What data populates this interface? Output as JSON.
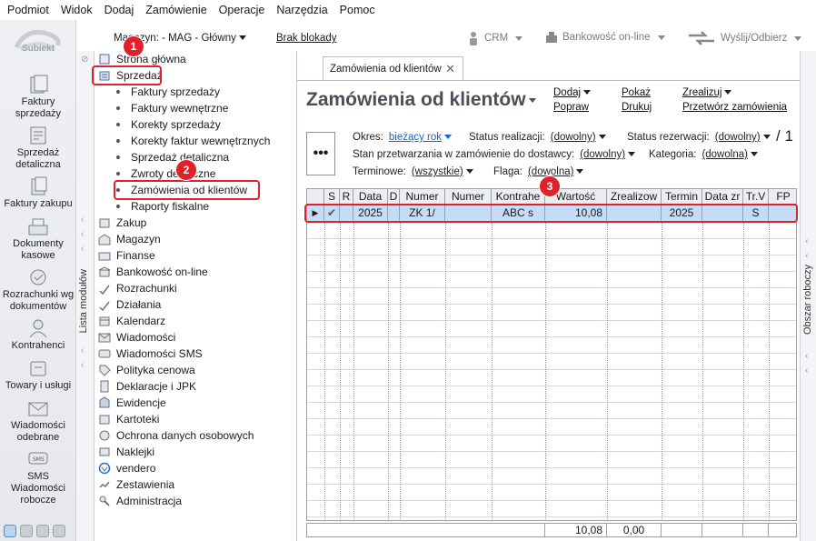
{
  "menu": [
    "Podmiot",
    "Widok",
    "Dodaj",
    "Zamówienie",
    "Operacje",
    "Narzędzia",
    "Pomoc"
  ],
  "toolbar": {
    "magazyn": "Magazyn: - MAG - Główny",
    "lock": "Brak blokady",
    "crm": "CRM",
    "bank": "Bankowość on-line",
    "send": "Wyślij/Odbierz"
  },
  "rail": {
    "logo": "Subiekt",
    "items": [
      "Faktury sprzedaży",
      "Sprzedaż detaliczna",
      "Faktury zakupu",
      "Dokumenty kasowe",
      "Rozrachunki wg dokumentów",
      "Kontrahenci",
      "Towary i usługi",
      "Wiadomości odebrane",
      "SMS Wiadomości robocze"
    ]
  },
  "strip": {
    "label": "Lista modułów"
  },
  "tree": {
    "top": [
      "Strona główna",
      "Sprzedaż"
    ],
    "sales_children": [
      "Faktury sprzedaży",
      "Faktury wewnętrzne",
      "Korekty sprzedaży",
      "Korekty faktur wewnętrznych",
      "Sprzedaż detaliczna",
      "Zwroty detaliczne",
      "Zamówienia od klientów",
      "Raporty fiskalne"
    ],
    "modules": [
      "Zakup",
      "Magazyn",
      "Finanse",
      "Bankowość on-line",
      "Rozrachunki",
      "Działania",
      "Kalendarz",
      "Wiadomości",
      "Wiadomości SMS",
      "Polityka cenowa",
      "Deklaracje i JPK",
      "Ewidencje",
      "Kartoteki",
      "Ochrona danych osobowych",
      "Naklejki",
      "vendero",
      "Zestawienia",
      "Administracja"
    ]
  },
  "badges": [
    "1",
    "2",
    "3"
  ],
  "main": {
    "tab": "Zamówienia od klientów",
    "title": "Zamówienia od klientów",
    "actions": [
      "Dodaj",
      "Pokaż",
      "Zrealizuj",
      "Popraw",
      "Drukuj",
      "Przetwórz zamówienia"
    ],
    "dots": "•••",
    "filters": {
      "okres_label": "Okres:",
      "okres_value": "bieżący rok",
      "status_real_label": "Status realizacji:",
      "status_real_value": "(dowolny)",
      "status_rez_label": "Status rezerwacji:",
      "status_rez_value": "(dowolny)",
      "page_indicator": "/ 1",
      "stan_label": "Stan przetwarzania w zamówienie do dostawcy:",
      "stan_value": "(dowolny)",
      "kategoria_label": "Kategoria:",
      "kategoria_value": "(dowolna)",
      "terminowe_label": "Terminowe:",
      "terminowe_value": "(wszystkie)",
      "flaga_label": "Flaga:",
      "flaga_value": "(dowolna)"
    },
    "columns": [
      "",
      "S",
      "R",
      "Data",
      "D",
      "Numer",
      "Numer",
      "Kontrahe",
      "Wartość",
      "Zrealizow",
      "Termin",
      "Data zr",
      "Tr.V",
      "FP"
    ],
    "row": [
      "▶",
      "✔",
      "",
      "2025",
      "",
      "ZK 1/",
      "",
      "ABC s",
      "10,08",
      "",
      "2025",
      "",
      "S",
      ""
    ],
    "totals": {
      "wartosc": "10,08",
      "zrealizowano": "0,00"
    }
  },
  "rstrip": {
    "label": "Obszar roboczy"
  }
}
